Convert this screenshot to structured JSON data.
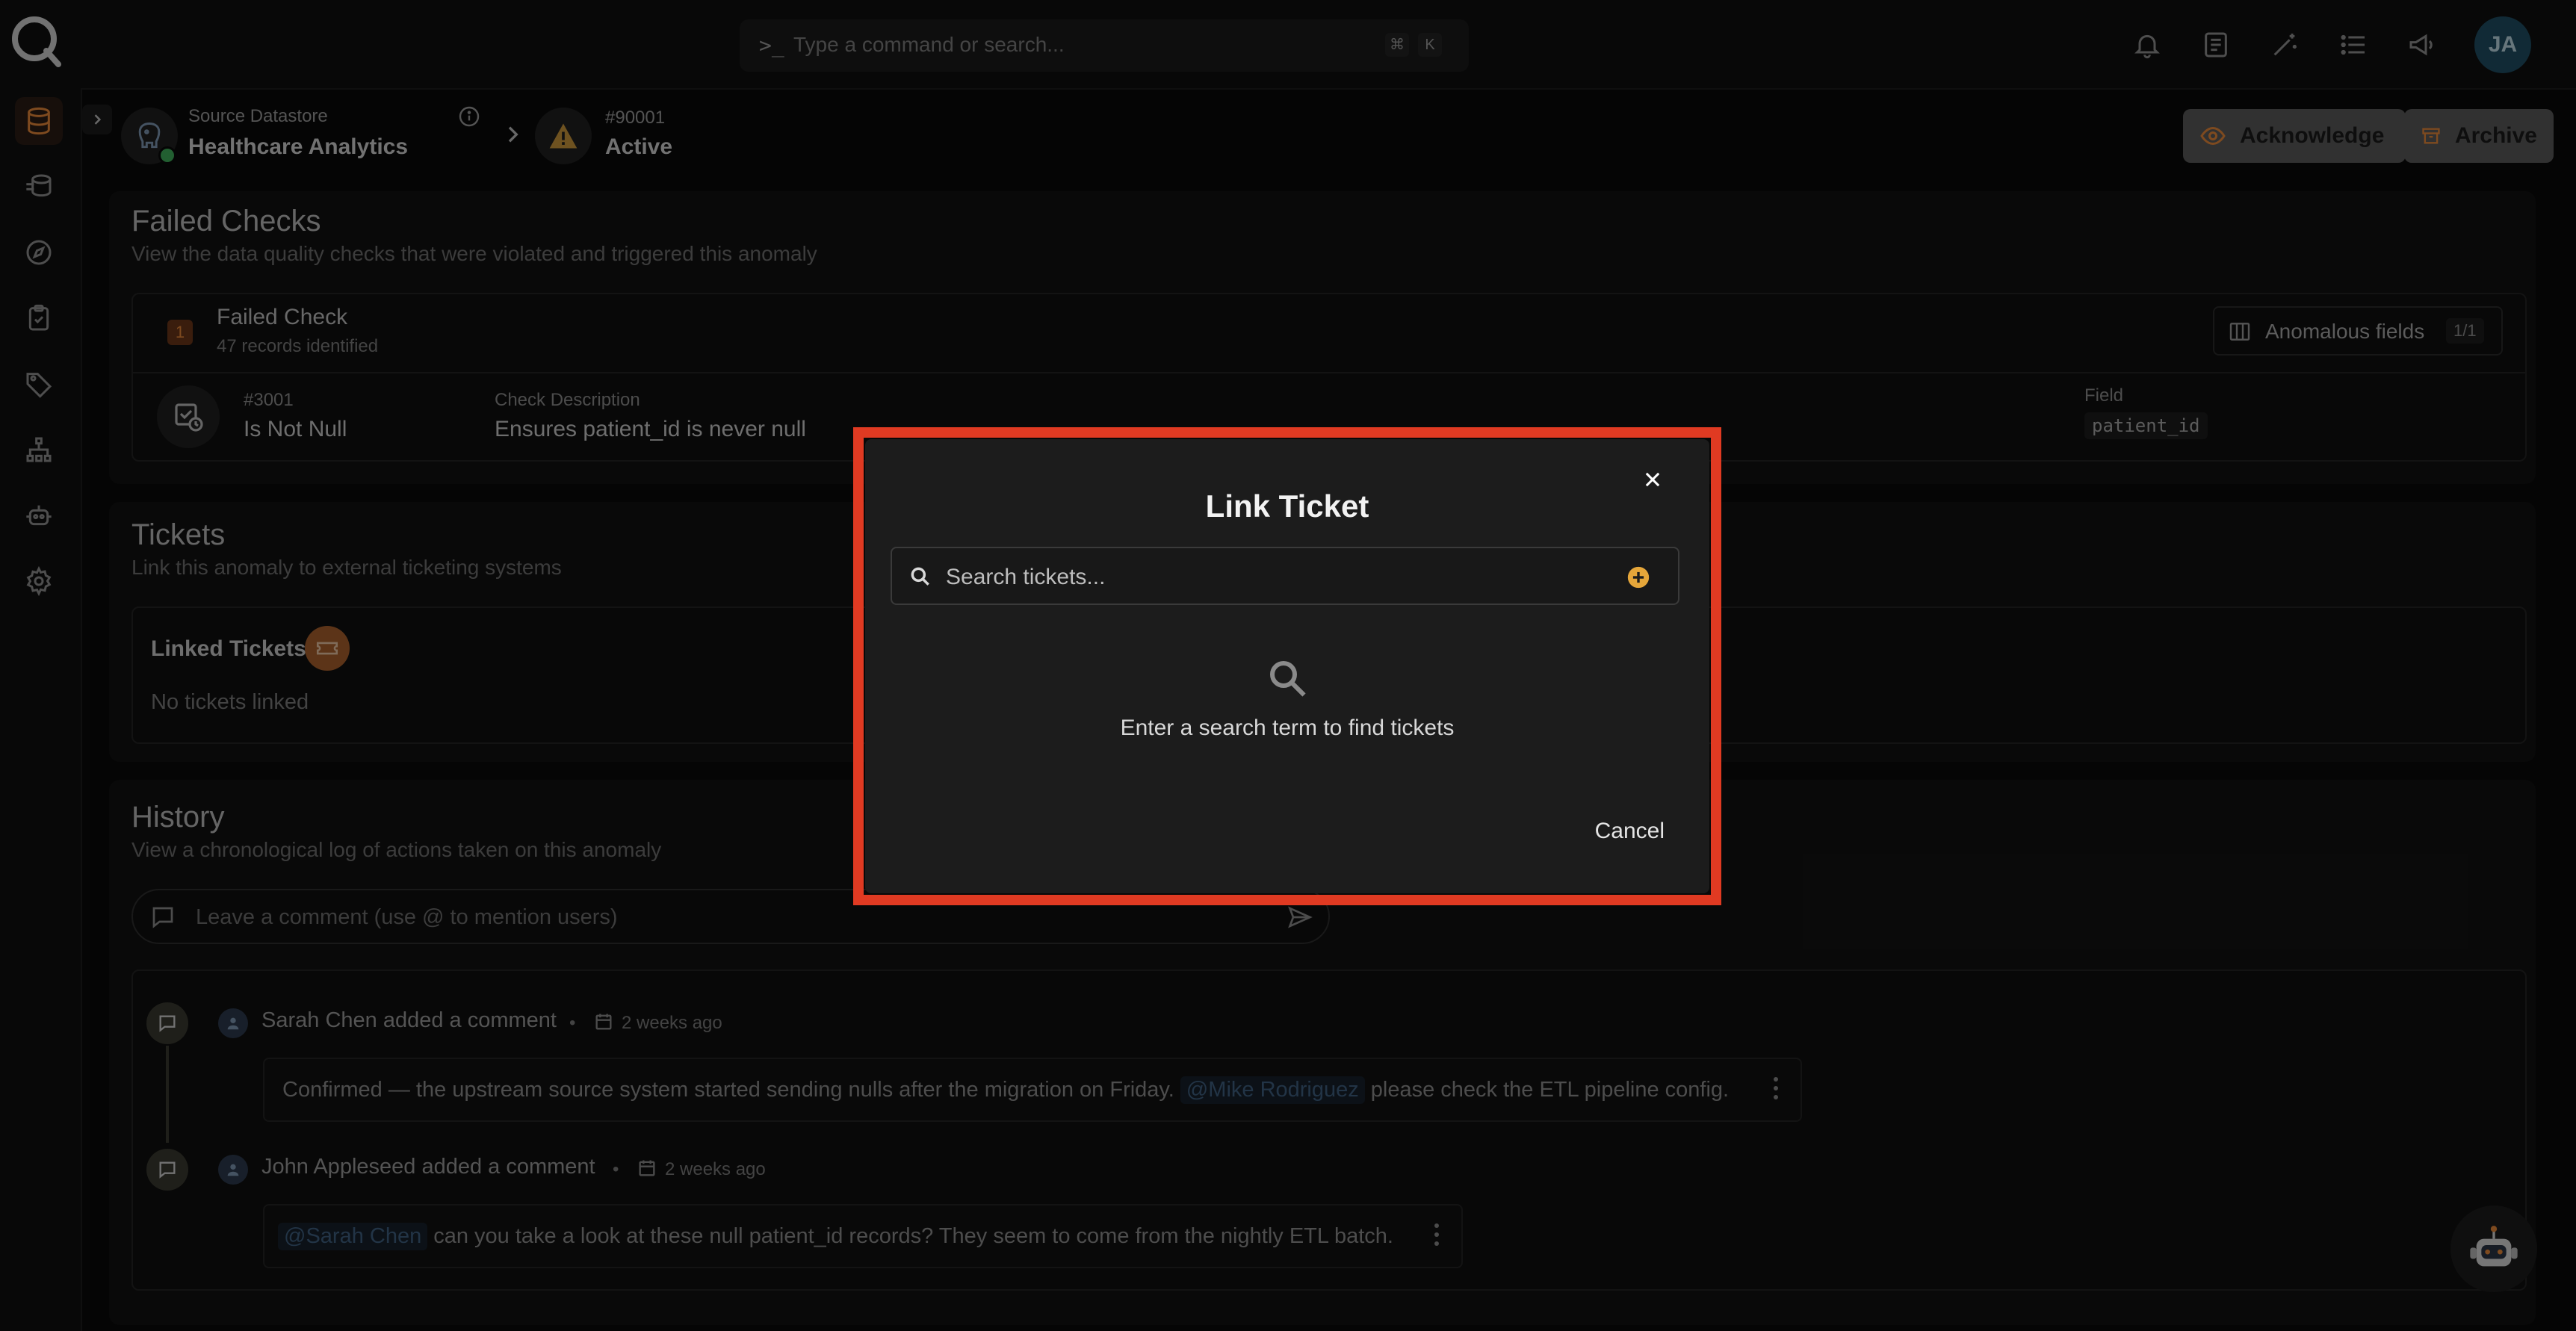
{
  "search": {
    "placeholder": "Type a command or search...",
    "kbd_mod": "⌘",
    "kbd_key": "K"
  },
  "user": {
    "initials": "JA"
  },
  "breadcrumb": {
    "datastore_label": "Source Datastore",
    "datastore_name": "Healthcare Analytics",
    "anomaly_id": "#90001",
    "anomaly_status": "Active"
  },
  "actions": {
    "acknowledge": "Acknowledge",
    "archive": "Archive"
  },
  "failed_checks": {
    "title": "Failed Checks",
    "subtitle": "View the data quality checks that were violated and triggered this anomaly",
    "count": "1",
    "label": "Failed Check",
    "records": "47 records identified",
    "anomalous_fields_label": "Anomalous fields",
    "anomalous_fields_count": "1/1",
    "check_id": "#3001",
    "check_name": "Is Not Null",
    "description_label": "Check Description",
    "description": "Ensures patient_id is never null",
    "field_label": "Field",
    "field_value": "patient_id"
  },
  "tickets": {
    "title": "Tickets",
    "subtitle": "Link this anomaly to external ticketing systems",
    "linked_label": "Linked Tickets",
    "empty": "No tickets linked"
  },
  "history": {
    "title": "History",
    "subtitle": "View a chronological log of actions taken on this anomaly",
    "comment_placeholder": "Leave a comment (use @ to mention users)",
    "comments": [
      {
        "author_action": "Sarah Chen added a comment",
        "time": "2 weeks ago",
        "text_before": "Confirmed — the upstream source system started sending nulls after the migration on Friday.",
        "mention": "@Mike Rodriguez",
        "text_after": "please check the ETL pipeline config."
      },
      {
        "author_action": "John Appleseed added a comment",
        "time": "2 weeks ago",
        "mention": "@Sarah Chen",
        "text_after": "can you take a look at these null patient_id records? They seem to come from the nightly ETL batch."
      }
    ]
  },
  "modal": {
    "title": "Link Ticket",
    "search_placeholder": "Search tickets...",
    "empty_message": "Enter a search term to find tickets",
    "cancel": "Cancel"
  },
  "colors": {
    "accent": "#e5883a",
    "highlight": "#e03a22",
    "status_online": "#3fae5a"
  }
}
